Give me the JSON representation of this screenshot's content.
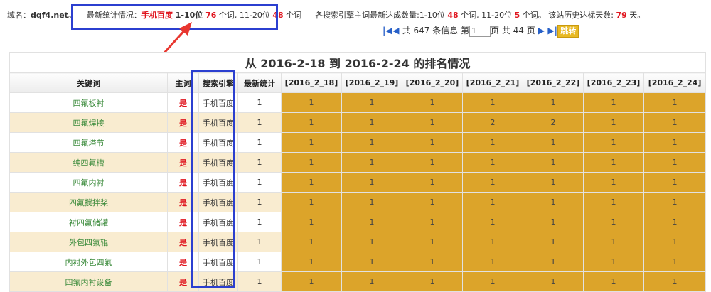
{
  "summary": {
    "domain_label": "域名：",
    "domain_value": "dqf4.net",
    "domain_dot": "。",
    "latest_label": "最新统计情况：",
    "engine_name": "手机百度",
    "top10_label": " 1-10位 ",
    "top10_value": "76",
    "top10_unit": " 个词, 11-20位 ",
    "top20_value": "48",
    "top20_unit": " 个词",
    "engines_text": "各搜索引擎主词最新达成数量:1-10位 ",
    "engines_top10": "48",
    "engines_mid": " 个词, 11-20位 ",
    "engines_top20": "5",
    "engines_mid2": " 个词。 该站历史达标天数: ",
    "history_days": "79",
    "history_unit": " 天。"
  },
  "pager": {
    "first_icon": "first-page-icon",
    "prev_icon": "prev-page-icon",
    "total_text": " 共 647 条信息 第",
    "page_value": "1",
    "pages_text": "页 共 44 页 ",
    "next_icon": "next-page-icon",
    "last_icon": "last-page-icon",
    "jump_label": "跳转"
  },
  "table": {
    "caption": "从 2016-2-18 到 2016-2-24 的排名情况",
    "headers": [
      "关键词",
      "主词",
      "搜索引擎",
      "最新统计",
      "[2016_2_18]",
      "[2016_2_19]",
      "[2016_2_20]",
      "[2016_2_21]",
      "[2016_2_22]",
      "[2016_2_23]",
      "[2016_2_24]"
    ],
    "rows": [
      {
        "kw": "四氟板衬",
        "main": "是",
        "engine": "手机百度",
        "latest": "1",
        "days": [
          "1",
          "1",
          "1",
          "1",
          "1",
          "1",
          "1"
        ]
      },
      {
        "kw": "四氟焊接",
        "main": "是",
        "engine": "手机百度",
        "latest": "1",
        "days": [
          "1",
          "1",
          "1",
          "2",
          "2",
          "1",
          "1"
        ]
      },
      {
        "kw": "四氟塔节",
        "main": "是",
        "engine": "手机百度",
        "latest": "1",
        "days": [
          "1",
          "1",
          "1",
          "1",
          "1",
          "1",
          "1"
        ]
      },
      {
        "kw": "纯四氟槽",
        "main": "是",
        "engine": "手机百度",
        "latest": "1",
        "days": [
          "1",
          "1",
          "1",
          "1",
          "1",
          "1",
          "1"
        ]
      },
      {
        "kw": "四氟内衬",
        "main": "是",
        "engine": "手机百度",
        "latest": "1",
        "days": [
          "1",
          "1",
          "1",
          "1",
          "1",
          "1",
          "1"
        ]
      },
      {
        "kw": "四氟搅拌桨",
        "main": "是",
        "engine": "手机百度",
        "latest": "1",
        "days": [
          "1",
          "1",
          "1",
          "1",
          "1",
          "1",
          "1"
        ]
      },
      {
        "kw": "衬四氟储罐",
        "main": "是",
        "engine": "手机百度",
        "latest": "1",
        "days": [
          "1",
          "1",
          "1",
          "1",
          "1",
          "1",
          "1"
        ]
      },
      {
        "kw": "外包四氟辊",
        "main": "是",
        "engine": "手机百度",
        "latest": "1",
        "days": [
          "1",
          "1",
          "1",
          "1",
          "1",
          "1",
          "1"
        ]
      },
      {
        "kw": "内衬外包四氟",
        "main": "是",
        "engine": "手机百度",
        "latest": "1",
        "days": [
          "1",
          "1",
          "1",
          "1",
          "1",
          "1",
          "1"
        ]
      },
      {
        "kw": "四氟内衬设备",
        "main": "是",
        "engine": "手机百度",
        "latest": "1",
        "days": [
          "1",
          "1",
          "1",
          "1",
          "1",
          "1",
          "1"
        ]
      }
    ]
  },
  "colors": {
    "highlight_box": "#2b3fd0",
    "rank_cell": "#dca42a",
    "main_word": "#e0161f",
    "keyword_link": "#3a8a3a",
    "arrow": "#e8362f"
  }
}
